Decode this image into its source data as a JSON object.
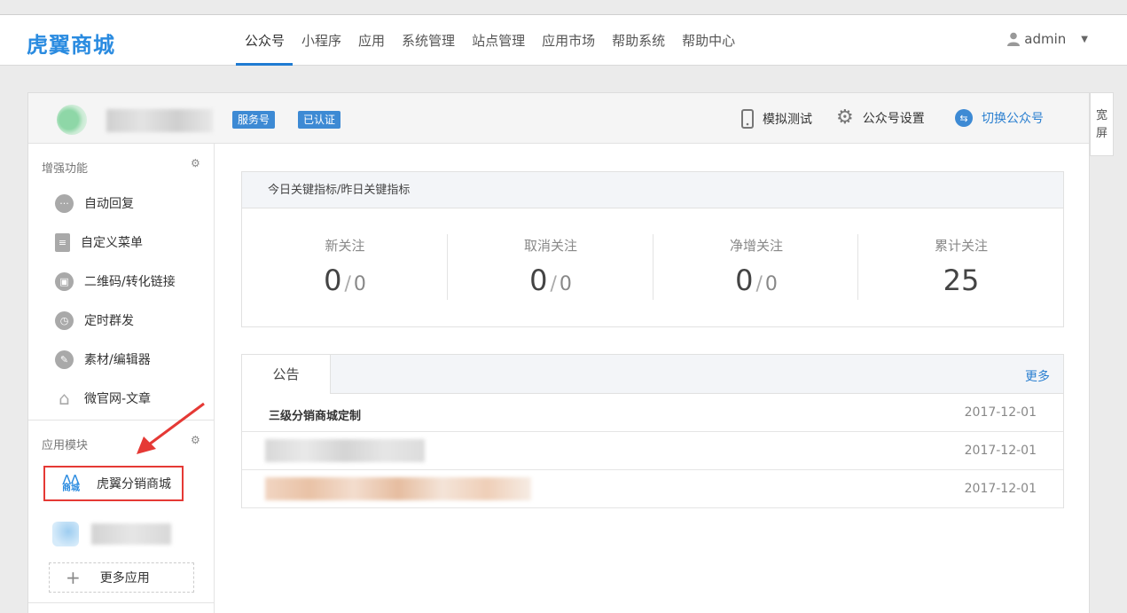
{
  "brand": {
    "logo": "虎翼商城"
  },
  "nav": {
    "items": [
      "公众号",
      "小程序",
      "应用",
      "系统管理",
      "站点管理",
      "应用市场",
      "帮助系统",
      "帮助中心"
    ],
    "active": "公众号"
  },
  "user": {
    "name": "admin"
  },
  "account": {
    "tags": [
      "服务号",
      "已认证"
    ],
    "tools": {
      "simulate": "模拟测试",
      "settings": "公众号设置",
      "switch": "切换公众号"
    }
  },
  "side_toggle": {
    "label": "宽屏"
  },
  "sidebar": {
    "enhanced_title": "增强功能",
    "enhanced_items": [
      {
        "label": "自动回复",
        "icon": "chat-icon"
      },
      {
        "label": "自定义菜单",
        "icon": "document-edit-icon"
      },
      {
        "label": "二维码/转化链接",
        "icon": "qrcode-icon"
      },
      {
        "label": "定时群发",
        "icon": "clock-icon"
      },
      {
        "label": "素材/编辑器",
        "icon": "pencil-icon"
      },
      {
        "label": "微官网-文章",
        "icon": "house-icon"
      }
    ],
    "modules_title": "应用模块",
    "app": {
      "label": "虎翼分销商城",
      "logo_text": "商城"
    },
    "more_apps": "更多应用"
  },
  "stats": {
    "header": "今日关键指标/昨日关键指标",
    "items": [
      {
        "label": "新关注",
        "today": "0",
        "yesterday": "0"
      },
      {
        "label": "取消关注",
        "today": "0",
        "yesterday": "0"
      },
      {
        "label": "净增关注",
        "today": "0",
        "yesterday": "0"
      },
      {
        "label": "累计关注",
        "value": "25"
      }
    ]
  },
  "notice": {
    "tab": "公告",
    "more": "更多",
    "rows": [
      {
        "title": "三级分销商城定制",
        "date": "2017-12-01"
      },
      {
        "title": "",
        "date": "2017-12-01"
      },
      {
        "title": "",
        "date": "2017-12-01"
      }
    ]
  },
  "colors": {
    "accent": "#1f7bd2",
    "tag": "#3d8ad4",
    "highlight": "#e53935"
  }
}
